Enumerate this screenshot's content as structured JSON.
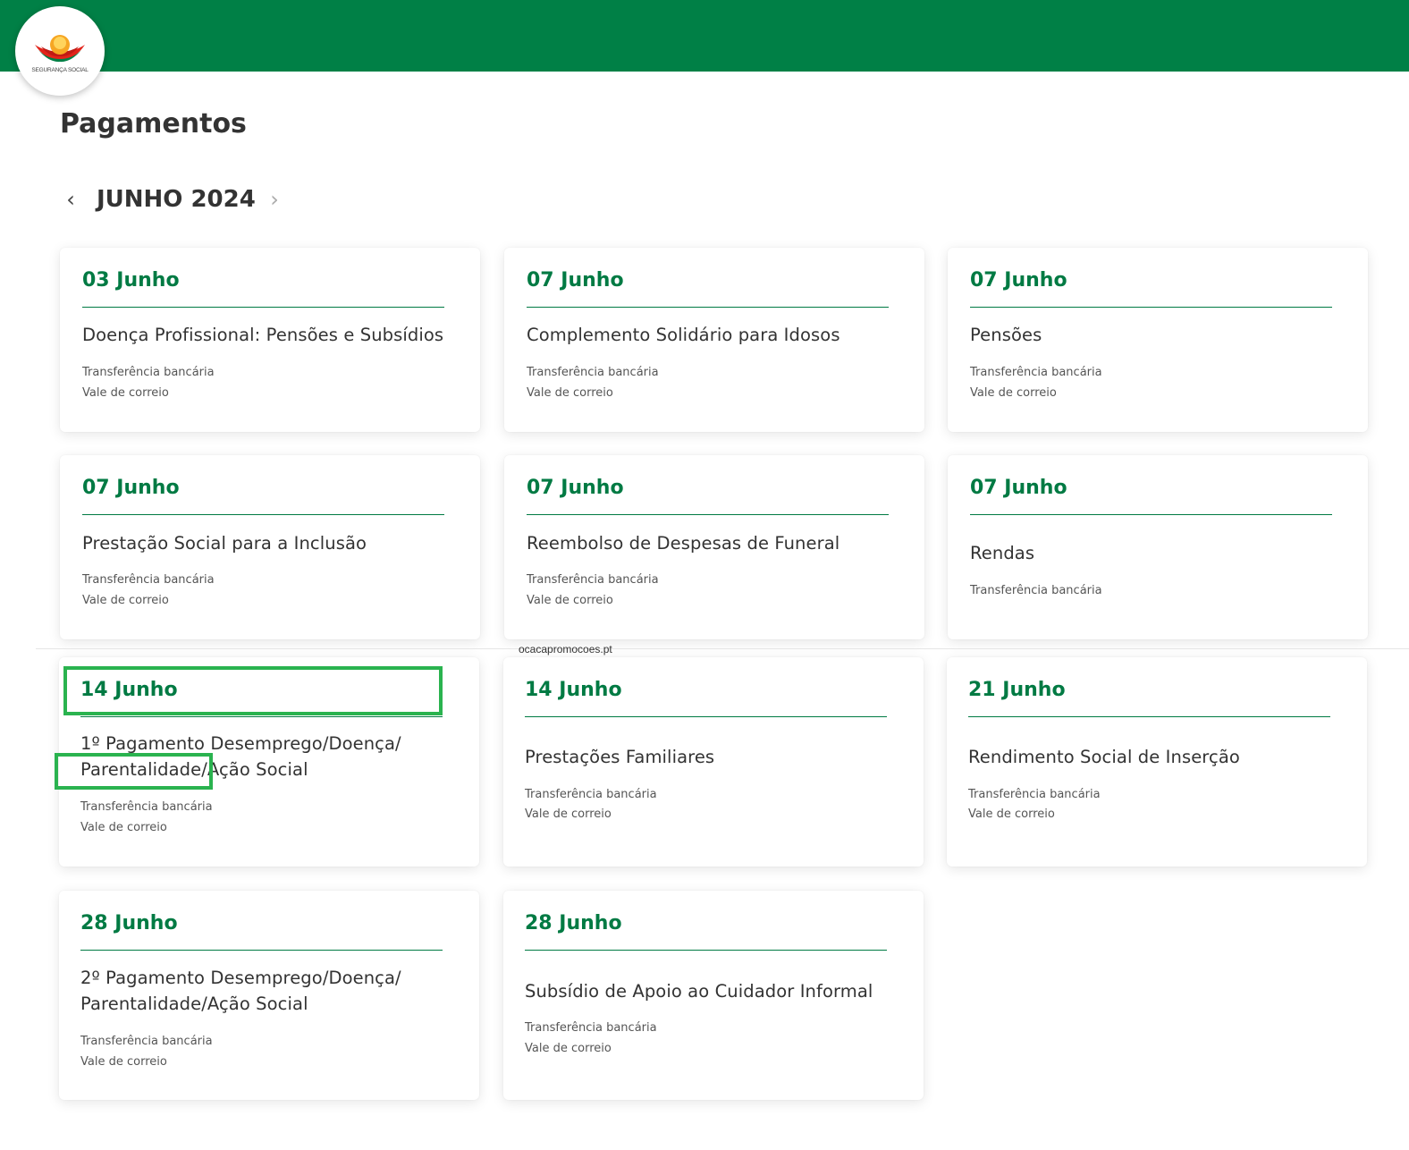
{
  "header": {
    "brand_color": "#008046",
    "logo_text": "SEGURANÇA SOCIAL"
  },
  "page": {
    "title": "Pagamentos"
  },
  "month_nav": {
    "label": "JUNHO 2024",
    "prev_icon": "chevron-left-icon",
    "next_icon": "chevron-right-icon"
  },
  "cards": [
    {
      "date": "03 Junho",
      "title": "Doença Profissional: Pensões e Subsídios",
      "methods": [
        "Transferência bancária",
        "Vale de correio"
      ]
    },
    {
      "date": "07 Junho",
      "title": "Complemento Solidário para Idosos",
      "methods": [
        "Transferência bancária",
        "Vale de correio"
      ]
    },
    {
      "date": "07 Junho",
      "title": "Pensões",
      "methods": [
        "Transferência bancária",
        "Vale de correio"
      ]
    },
    {
      "date": "07 Junho",
      "title": "Prestação Social para a Inclusão",
      "methods": [
        "Transferência bancária",
        "Vale de correio"
      ]
    },
    {
      "date": "07 Junho",
      "title": "Reembolso de Despesas de Funeral",
      "methods": [
        "Transferência bancária",
        "Vale de correio"
      ]
    },
    {
      "date": "07 Junho",
      "title": "Rendas",
      "methods": [
        "Transferência bancária"
      ]
    },
    {
      "date": "14 Junho",
      "title_lines": [
        "1º Pagamento Desemprego/Doença/",
        "Parentalidade/Ação Social"
      ],
      "methods": [
        "Transferência bancária",
        "Vale de correio"
      ]
    },
    {
      "date": "14 Junho",
      "title": "Prestações Familiares",
      "methods": [
        "Transferência bancária",
        "Vale de correio"
      ]
    },
    {
      "date": "21 Junho",
      "title": "Rendimento Social de Inserção",
      "methods": [
        "Transferência bancária",
        "Vale de correio"
      ]
    },
    {
      "date": "28 Junho",
      "title_lines": [
        "2º Pagamento Desemprego/Doença/",
        "Parentalidade/Ação Social"
      ],
      "methods": [
        "Transferência bancária",
        "Vale de correio"
      ]
    },
    {
      "date": "28 Junho",
      "title": "Subsídio de Apoio ao Cuidador Informal",
      "methods": [
        "Transferência bancária",
        "Vale de correio"
      ]
    }
  ],
  "watermark": "ocacapromocoes.pt",
  "highlight_color": "#2ab34f"
}
